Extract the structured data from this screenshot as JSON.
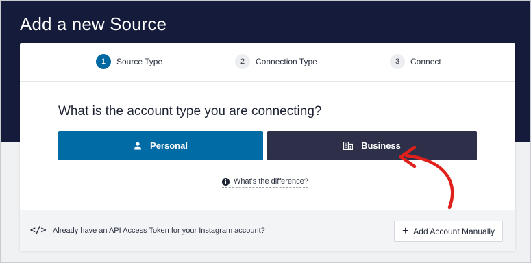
{
  "header": {
    "title": "Add a new Source"
  },
  "steps": [
    {
      "number": "1",
      "label": "Source Type",
      "active": true
    },
    {
      "number": "2",
      "label": "Connection Type",
      "active": false
    },
    {
      "number": "3",
      "label": "Connect",
      "active": false
    }
  ],
  "main": {
    "question": "What is the account type you are connecting?",
    "personal_label": "Personal",
    "business_label": "Business",
    "help_label": "What's the difference?"
  },
  "footer": {
    "text": "Already have an API Access Token for your Instagram account?",
    "add_label": "Add Account Manually"
  },
  "icons": {
    "personal": "person-icon",
    "business": "building-icon",
    "help": "info-icon",
    "code": "code-icon",
    "add": "plus-icon",
    "annotation": "red-arrow"
  },
  "colors": {
    "header_bg": "#151b3a",
    "personal_btn": "#006ba5",
    "business_btn": "#2e3049",
    "active_step": "#0068a0",
    "annotation_arrow": "#e0211b"
  }
}
